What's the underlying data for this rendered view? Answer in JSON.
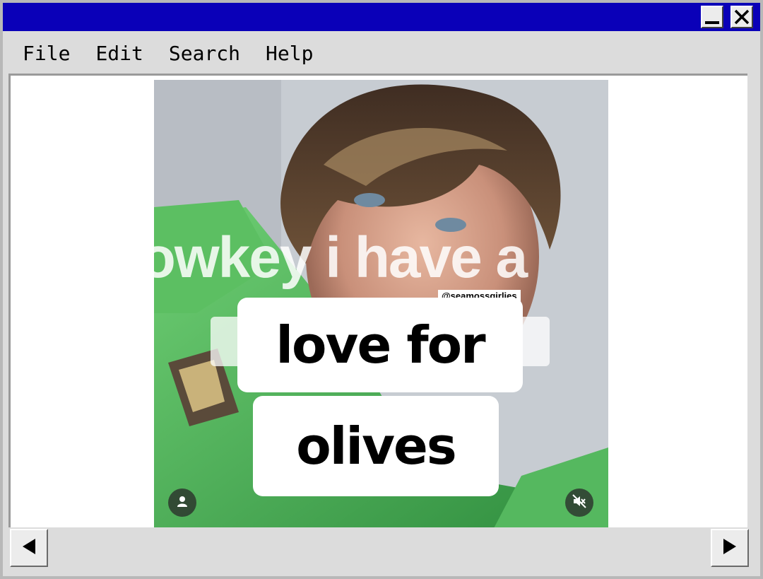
{
  "window": {
    "minimize_icon": "minimize-icon",
    "close_icon": "close-icon",
    "titlebar_color": "#0a00b8"
  },
  "menu": {
    "items": [
      "File",
      "Edit",
      "Search",
      "Help"
    ]
  },
  "post": {
    "caption_background_text": "lowkey i have a",
    "watermark": "@seamossgirlies",
    "caption_line_1": "love for",
    "caption_line_2": "olives",
    "user_icon": "user-icon",
    "mute_icon": "muted-speaker-icon"
  },
  "scrollbar": {
    "left_icon": "arrow-left-icon",
    "right_icon": "arrow-right-icon"
  }
}
